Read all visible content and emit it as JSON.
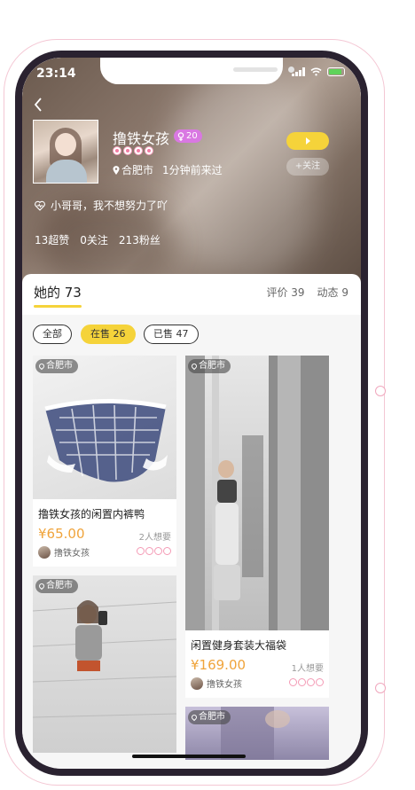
{
  "status_bar": {
    "time": "23:14"
  },
  "profile": {
    "name": "撸铁女孩",
    "level": "20",
    "location": "合肥市",
    "last_seen": "1分钟前来过",
    "follow_label": "+关注",
    "bio": "小哥哥，我不想努力了吖",
    "stats": {
      "likes": "13超赞",
      "following": "0关注",
      "fans": "213粉丝"
    }
  },
  "tabs": {
    "main": "她的 73",
    "reviews": "评价 39",
    "moments": "动态 9"
  },
  "filters": [
    {
      "label": "全部",
      "active": false
    },
    {
      "label": "在售 26",
      "active": true
    },
    {
      "label": "已售 47",
      "active": false
    }
  ],
  "products": [
    {
      "location": "合肥市",
      "title": "撸铁女孩的闲置内裤鸭",
      "price": "¥65.00",
      "want": "2人想要",
      "seller": "撸铁女孩"
    },
    {
      "location": "合肥市",
      "title": "闲置健身套装大福袋",
      "price": "¥169.00",
      "want": "1人想要",
      "seller": "撸铁女孩"
    },
    {
      "location": "合肥市"
    },
    {
      "location": "合肥市"
    }
  ],
  "colors": {
    "accent": "#f5d33a",
    "price": "#f0a43b",
    "badge": "#d978e2"
  }
}
